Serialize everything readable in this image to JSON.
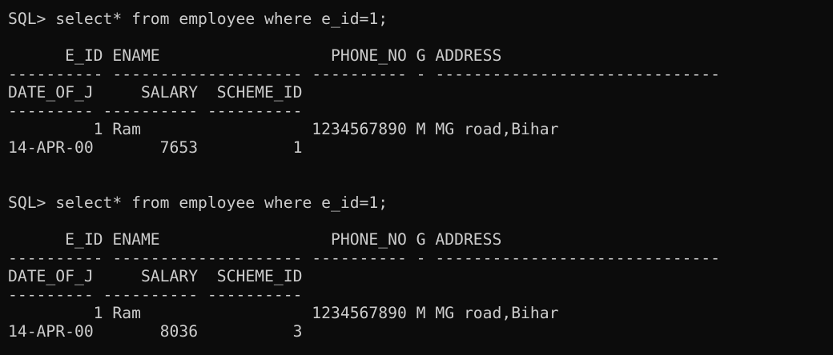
{
  "terminal": {
    "foreground": "#cccccc",
    "background": "#0c0c0c",
    "lines": [
      "SQL> select* from employee where e_id=1;",
      "",
      "      E_ID ENAME                  PHONE_NO G ADDRESS",
      "---------- -------------------- ---------- - ------------------------------",
      "DATE_OF_J     SALARY  SCHEME_ID",
      "--------- ---------- ----------",
      "         1 Ram                  1234567890 M MG road,Bihar",
      "14-APR-00       7653          1",
      "",
      "",
      "SQL> select* from employee where e_id=1;",
      "",
      "      E_ID ENAME                  PHONE_NO G ADDRESS",
      "---------- -------------------- ---------- - ------------------------------",
      "DATE_OF_J     SALARY  SCHEME_ID",
      "--------- ---------- ----------",
      "         1 Ram                  1234567890 M MG road,Bihar",
      "14-APR-00       8036          3"
    ]
  }
}
